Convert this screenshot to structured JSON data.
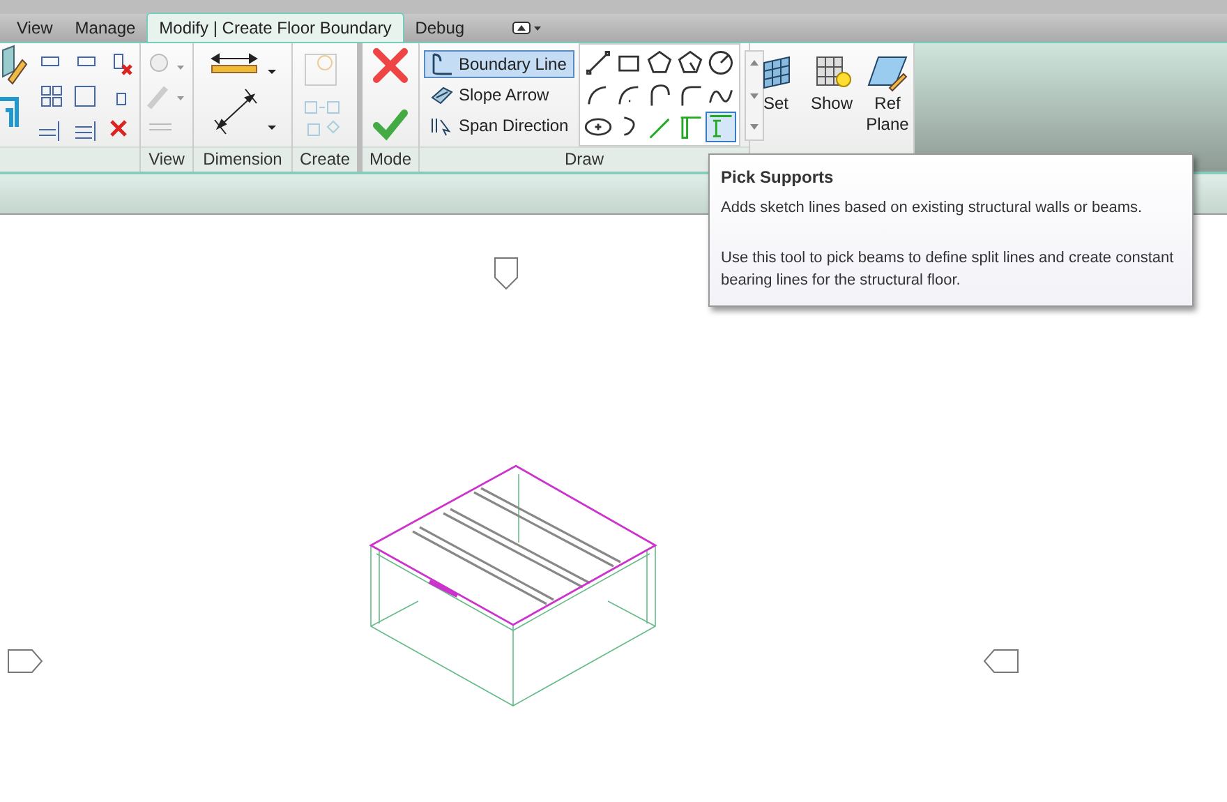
{
  "tabs": [
    {
      "label": "View",
      "selected": false
    },
    {
      "label": "Manage",
      "selected": false
    },
    {
      "label": "Modify | Create Floor Boundary",
      "selected": true
    },
    {
      "label": "Debug",
      "selected": false
    }
  ],
  "panel_labels": {
    "view": "View",
    "dimension": "Dimension",
    "create": "Create",
    "mode": "Mode",
    "draw": "Draw"
  },
  "mode_buttons": [
    {
      "kind": "cancel"
    },
    {
      "kind": "finish"
    }
  ],
  "draw_buttons": [
    {
      "label": "Boundary Line",
      "kind": "boundary",
      "selected": true
    },
    {
      "label": "Slope Arrow",
      "kind": "slope",
      "selected": false
    },
    {
      "label": "Span Direction",
      "kind": "span",
      "selected": false
    }
  ],
  "draw_tools": [
    {
      "kind": "line",
      "selected": false
    },
    {
      "kind": "rectangle",
      "selected": false
    },
    {
      "kind": "inscribed-polygon",
      "selected": false
    },
    {
      "kind": "circumscribed-polygon",
      "selected": false
    },
    {
      "kind": "circle",
      "selected": false
    },
    {
      "kind": "arc-3pt",
      "selected": false
    },
    {
      "kind": "arc-center",
      "selected": false
    },
    {
      "kind": "arc-tangent",
      "selected": false
    },
    {
      "kind": "fillet",
      "selected": false
    },
    {
      "kind": "spline",
      "selected": false
    },
    {
      "kind": "ellipse",
      "selected": false
    },
    {
      "kind": "partial-ellipse",
      "selected": false
    },
    {
      "kind": "pick-lines",
      "selected": false
    },
    {
      "kind": "pick-walls",
      "selected": false
    },
    {
      "kind": "pick-supports",
      "selected": true
    }
  ],
  "work_plane_buttons": [
    {
      "label": "Set",
      "kind": "set"
    },
    {
      "label": "Show",
      "kind": "show"
    },
    {
      "label": "Ref Plane",
      "kind": "plane"
    }
  ],
  "tooltip": {
    "title": "Pick Supports",
    "summary": "Adds sketch lines based on existing structural walls or beams.",
    "details": "Use this tool to pick beams to define split lines and create constant bearing lines for the structural floor."
  }
}
